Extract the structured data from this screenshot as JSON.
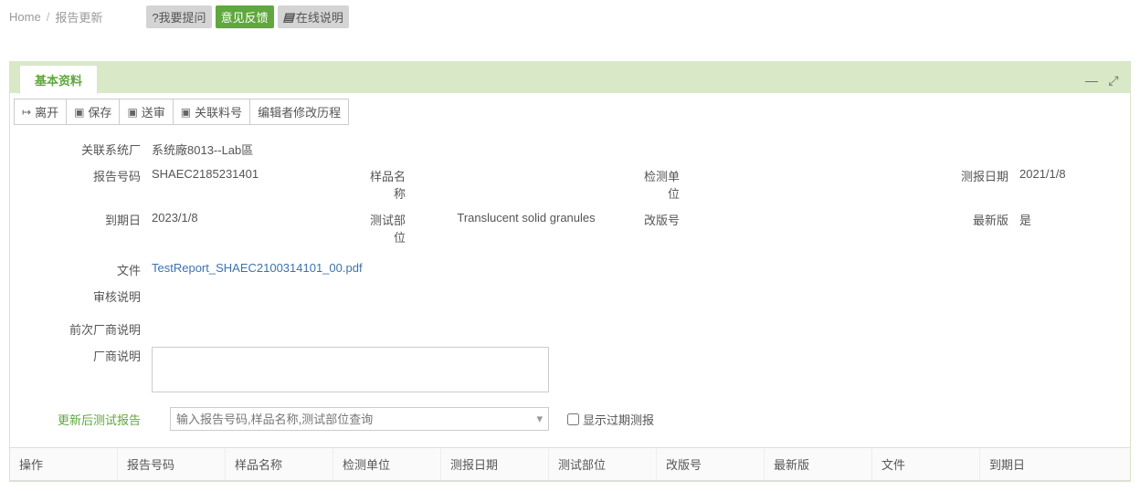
{
  "breadcrumb": {
    "home": "Home",
    "current": "报告更新"
  },
  "topButtons": {
    "ask": "?我要提问",
    "feedback": "意见反馈",
    "help": "在线说明"
  },
  "tab": {
    "label": "基本资料"
  },
  "toolbar": {
    "leave": "离开",
    "save": "保存",
    "submit": "送审",
    "linkPart": "关联料号",
    "editHistory": "编辑者修改历程"
  },
  "labels": {
    "linkedFactory": "关联系统厂",
    "reportNo": "报告号码",
    "sampleName": "样品名称",
    "detectUnit": "检测单位",
    "reportDate": "测报日期",
    "expireDate": "到期日",
    "testPart": "测试部位",
    "revision": "改版号",
    "latest": "最新版",
    "file": "文件",
    "auditNote": "审核说明",
    "prevVendorNote": "前次厂商说明",
    "vendorNote": "厂商说明",
    "updateReport": "更新后测试报告",
    "showExpired": "显示过期测报"
  },
  "values": {
    "linkedFactory": "系统廠8013--Lab區",
    "reportNo": "SHAEC2185231401",
    "sampleName": "",
    "detectUnit": "",
    "reportDate": "2021/1/8",
    "expireDate": "2023/1/8",
    "testPart": "Translucent solid granules",
    "revision": "",
    "latest": "是",
    "file": "TestReport_SHAEC2100314101_00.pdf"
  },
  "combo": {
    "placeholder": "输入报告号码,样品名称,测试部位查询"
  },
  "grid": {
    "headers": {
      "op": "操作",
      "reportNo": "报告号码",
      "sampleName": "样品名称",
      "detectUnit": "检测单位",
      "reportDate": "测报日期",
      "testPart": "测试部位",
      "revision": "改版号",
      "latest": "最新版",
      "file": "文件",
      "expireDate": "到期日"
    }
  }
}
